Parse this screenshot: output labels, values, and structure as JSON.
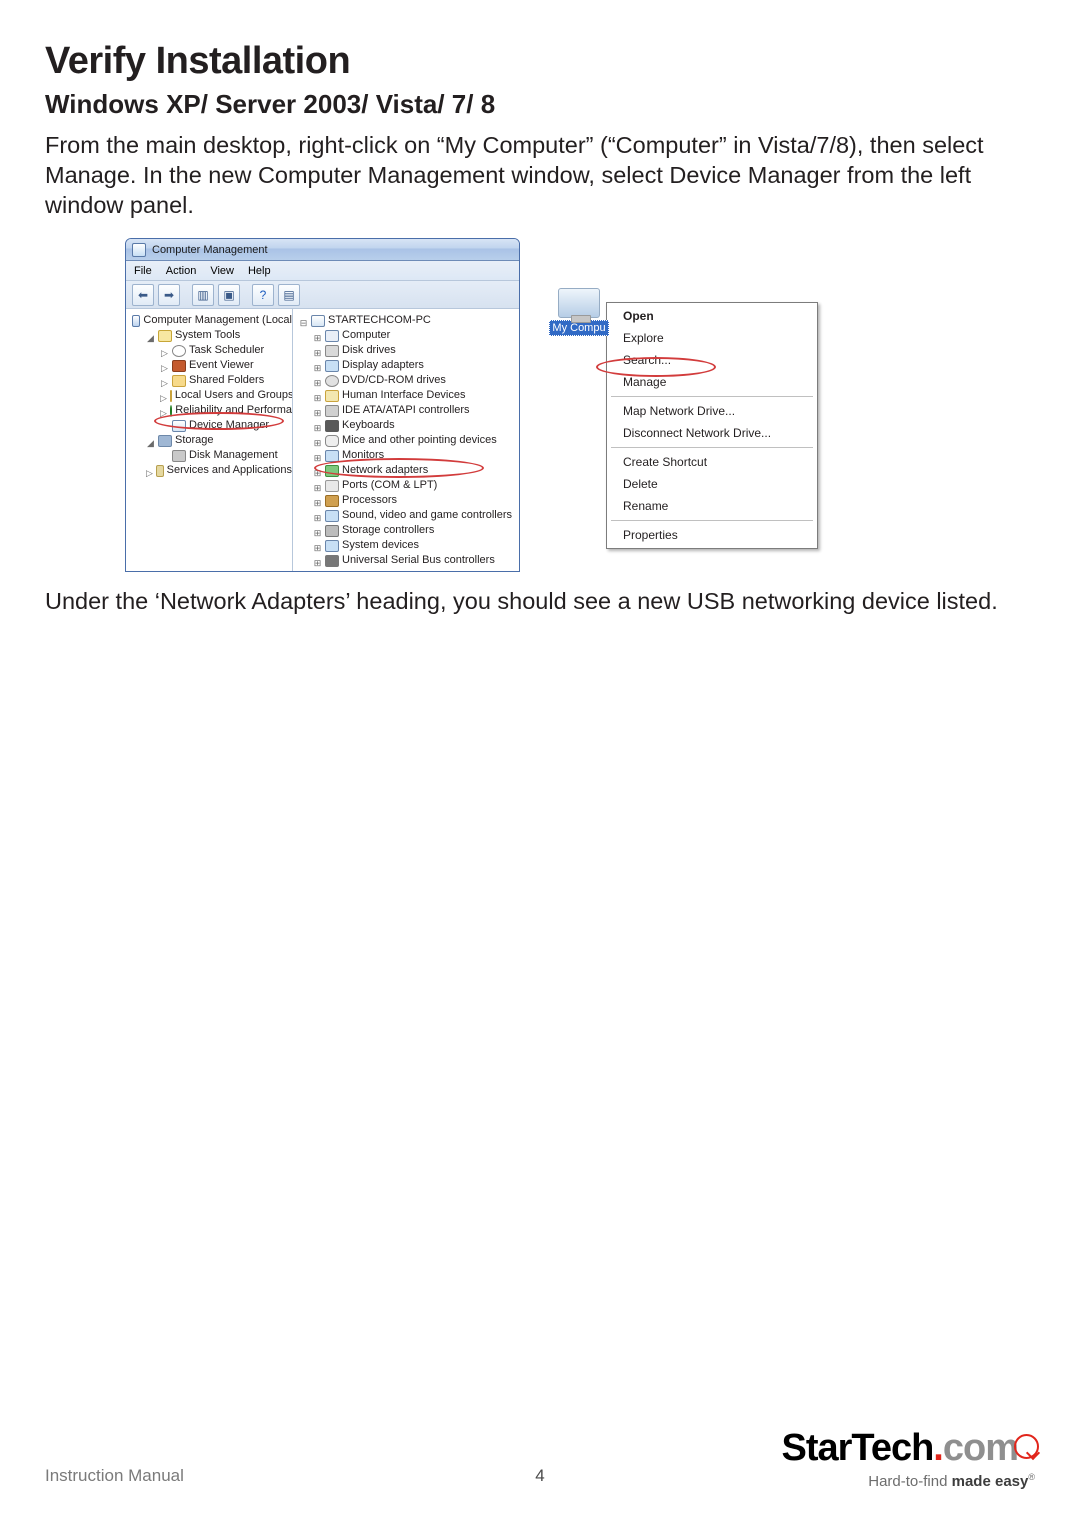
{
  "heading": "Verify Installation",
  "subheading": "Windows XP/ Server 2003/ Vista/ 7/ 8",
  "para1": "From the main desktop, right-click on “My Computer” (“Computer” in Vista/7/8), then select Manage. In the new Computer Management window, select Device Manager from the left window panel.",
  "para2": "Under the ‘Network Adapters’ heading, you should see a new USB networking device listed.",
  "cm": {
    "title": "Computer Management",
    "menu": {
      "file": "File",
      "action": "Action",
      "view": "View",
      "help": "Help"
    },
    "left": {
      "root": "Computer Management (Local",
      "systools": "System Tools",
      "task": "Task Scheduler",
      "event": "Event Viewer",
      "shared": "Shared Folders",
      "localusers": "Local Users and Groups",
      "reliability": "Reliability and Performa",
      "devmgr": "Device Manager",
      "storage": "Storage",
      "diskmgmt": "Disk Management",
      "services": "Services and Applications"
    },
    "right": {
      "root": "STARTECHCOM-PC",
      "computer": "Computer",
      "diskdrives": "Disk drives",
      "display": "Display adapters",
      "dvd": "DVD/CD-ROM drives",
      "hid": "Human Interface Devices",
      "ide": "IDE ATA/ATAPI controllers",
      "keyboards": "Keyboards",
      "mice": "Mice and other pointing devices",
      "monitors": "Monitors",
      "network": "Network adapters",
      "ports": "Ports (COM & LPT)",
      "processors": "Processors",
      "sound": "Sound, video and game controllers",
      "storagectrl": "Storage controllers",
      "sysdev": "System devices",
      "usb": "Universal Serial Bus controllers"
    }
  },
  "mycomputer_label": "My Compu",
  "ctx": {
    "open": "Open",
    "explore": "Explore",
    "search": "Search...",
    "manage": "Manage",
    "mapnet": "Map Network Drive...",
    "disconnect": "Disconnect Network Drive...",
    "createsc": "Create Shortcut",
    "delete": "Delete",
    "rename": "Rename",
    "properties": "Properties"
  },
  "footer": {
    "label": "Instruction Manual",
    "page": "4",
    "brand_a": "StarTech",
    "brand_b": "com",
    "tag_a": "Hard-to-find ",
    "tag_b": "made easy",
    "reg": "®"
  }
}
